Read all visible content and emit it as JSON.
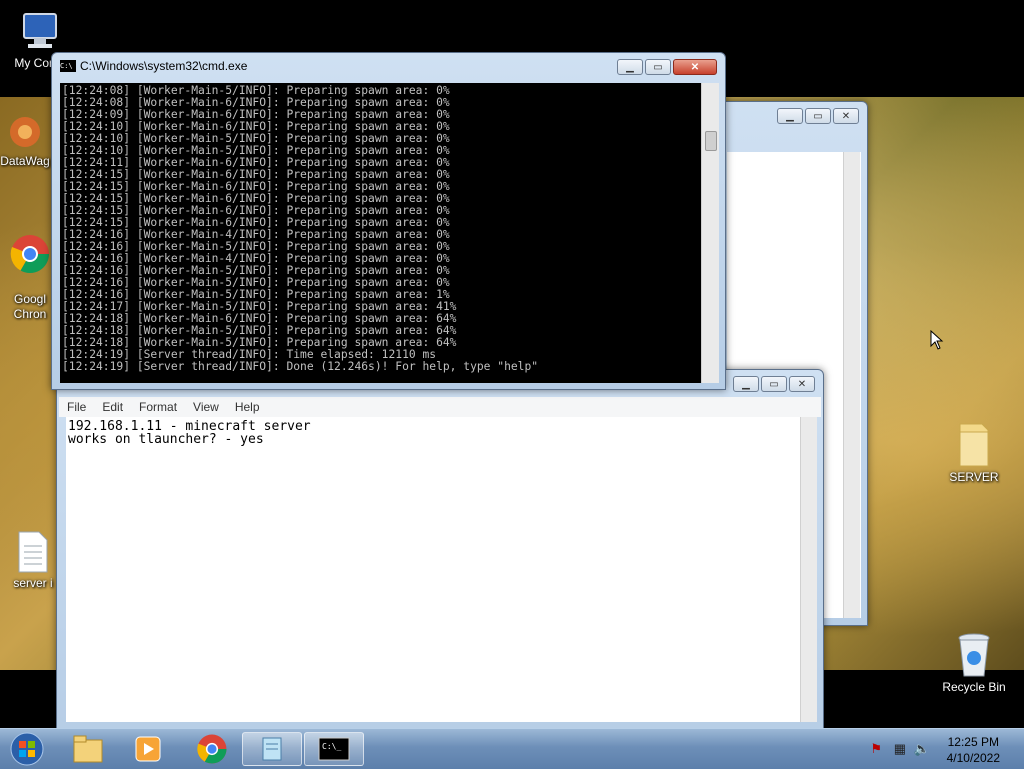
{
  "desktop": {
    "icons": [
      {
        "label": "My Comp",
        "icon": "computer-icon"
      },
      {
        "label": "DataWag",
        "icon": "datawag-icon"
      },
      {
        "label": "Googl\nChron",
        "icon": "chrome-icon"
      },
      {
        "label": "server i",
        "icon": "text-file-icon"
      },
      {
        "label": "SERVER",
        "icon": "folder-icon"
      },
      {
        "label": "Recycle Bin",
        "icon": "recycle-bin-icon"
      }
    ]
  },
  "cmd": {
    "title": "C:\\Windows\\system32\\cmd.exe",
    "lines": [
      "[12:24:08] [Worker-Main-5/INFO]: Preparing spawn area: 0%",
      "[12:24:08] [Worker-Main-6/INFO]: Preparing spawn area: 0%",
      "[12:24:09] [Worker-Main-6/INFO]: Preparing spawn area: 0%",
      "[12:24:10] [Worker-Main-6/INFO]: Preparing spawn area: 0%",
      "[12:24:10] [Worker-Main-5/INFO]: Preparing spawn area: 0%",
      "[12:24:10] [Worker-Main-5/INFO]: Preparing spawn area: 0%",
      "[12:24:11] [Worker-Main-6/INFO]: Preparing spawn area: 0%",
      "[12:24:15] [Worker-Main-6/INFO]: Preparing spawn area: 0%",
      "[12:24:15] [Worker-Main-6/INFO]: Preparing spawn area: 0%",
      "[12:24:15] [Worker-Main-6/INFO]: Preparing spawn area: 0%",
      "[12:24:15] [Worker-Main-6/INFO]: Preparing spawn area: 0%",
      "[12:24:15] [Worker-Main-6/INFO]: Preparing spawn area: 0%",
      "[12:24:16] [Worker-Main-4/INFO]: Preparing spawn area: 0%",
      "[12:24:16] [Worker-Main-5/INFO]: Preparing spawn area: 0%",
      "[12:24:16] [Worker-Main-4/INFO]: Preparing spawn area: 0%",
      "[12:24:16] [Worker-Main-5/INFO]: Preparing spawn area: 0%",
      "[12:24:16] [Worker-Main-5/INFO]: Preparing spawn area: 0%",
      "[12:24:16] [Worker-Main-5/INFO]: Preparing spawn area: 1%",
      "[12:24:17] [Worker-Main-5/INFO]: Preparing spawn area: 41%",
      "[12:24:18] [Worker-Main-6/INFO]: Preparing spawn area: 64%",
      "[12:24:18] [Worker-Main-5/INFO]: Preparing spawn area: 64%",
      "[12:24:18] [Worker-Main-5/INFO]: Preparing spawn area: 64%",
      "[12:24:19] [Server thread/INFO]: Time elapsed: 12110 ms",
      "[12:24:19] [Server thread/INFO]: Done (12.246s)! For help, type \"help\""
    ]
  },
  "notepad": {
    "menu": [
      "File",
      "Edit",
      "Format",
      "View",
      "Help"
    ],
    "text": "192.168.1.11 - minecraft server\nworks on tlauncher? - yes"
  },
  "taskbar": {
    "apps": [
      {
        "icon": "windows-start-icon"
      },
      {
        "icon": "file-explorer-icon"
      },
      {
        "icon": "media-player-icon"
      },
      {
        "icon": "chrome-icon"
      },
      {
        "icon": "notepad-icon"
      },
      {
        "icon": "cmd-icon"
      }
    ],
    "time": "12:25 PM",
    "date": "4/10/2022"
  }
}
